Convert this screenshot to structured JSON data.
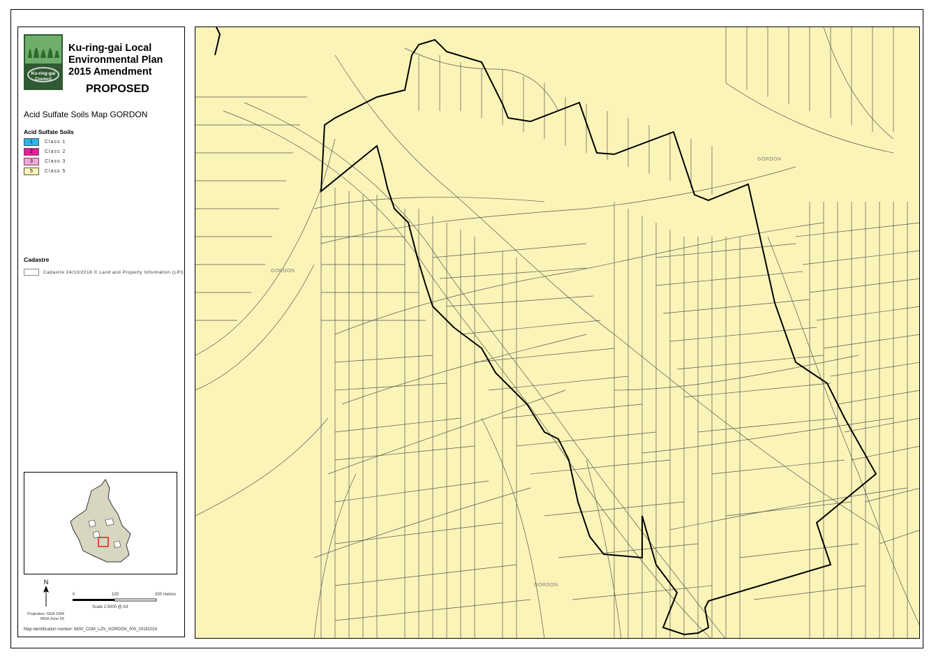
{
  "title_lines": [
    "Ku-ring-gai Local",
    "Environmental Plan",
    "2015 Amendment"
  ],
  "status": "PROPOSED",
  "map_name": "Acid Sulfate Soils Map GORDON",
  "logo_text": [
    "Ku-ring-gai",
    "Council"
  ],
  "legend": {
    "heading": "Acid Sulfate Soils",
    "classes": [
      {
        "code": "1",
        "label": "Class 1",
        "color": "#29b6e8"
      },
      {
        "code": "2",
        "label": "Class 2",
        "color": "#e61e9c"
      },
      {
        "code": "3",
        "label": "Class 3",
        "color": "#f4a6d6"
      },
      {
        "code": "5",
        "label": "Class 5",
        "color": "#fbf4b8"
      }
    ],
    "cadastre_heading": "Cadastre",
    "cadastre_label": "Cadastre 24/10/2018 © Land and Property Information (LPI)"
  },
  "north_label": "N",
  "scale": {
    "ticks": [
      "0",
      "100",
      "200 metres"
    ],
    "text": "Scale  1:5000  @ A3"
  },
  "projection": [
    "Projection: GDA 1994",
    "MGA Zone 56"
  ],
  "map_id": "Map identification number: 6800_COM_LZN_GORDON_005_20181024",
  "suburb_labels": [
    "GORDON",
    "GORDON",
    "GORDON"
  ],
  "colors": {
    "soil_class_5": "#fbf4b8",
    "cadastre_line": "#555555",
    "boundary": "#000000",
    "inset_lga": "#d8d6c0",
    "inset_marker": "#e0211b"
  }
}
